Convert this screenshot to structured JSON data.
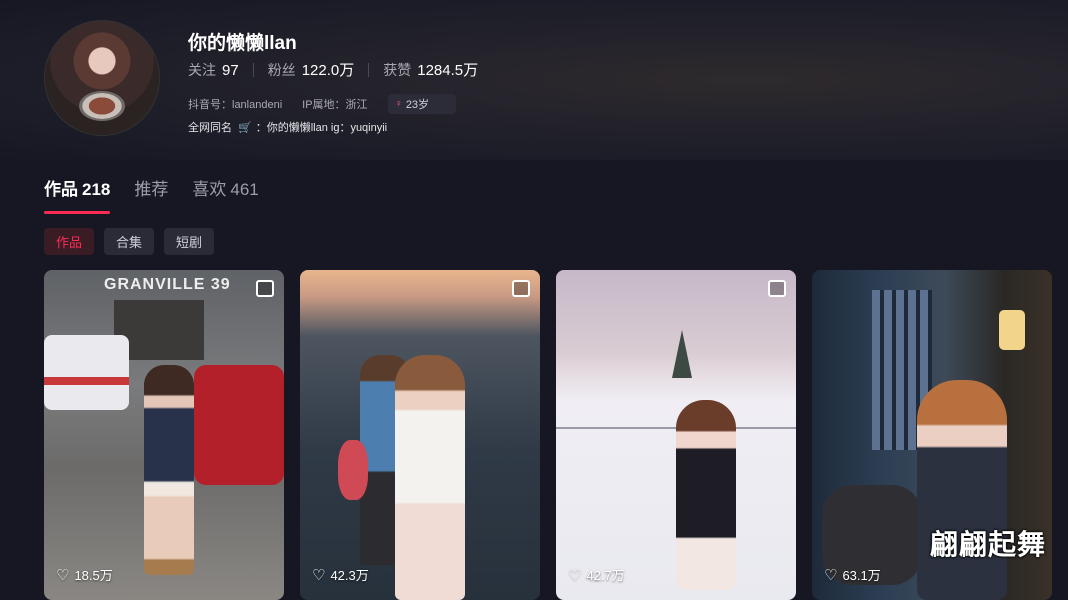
{
  "profile": {
    "name": "你的懒懒llan",
    "stats": [
      {
        "label": "关注",
        "value": "97"
      },
      {
        "label": "粉丝",
        "value": "122.0万"
      },
      {
        "label": "获赞",
        "value": "1284.5万"
      }
    ],
    "douyin_id": "抖音号：lanlandeni",
    "ip_location": "IP属地：浙江",
    "age_badge": "23岁",
    "age_icon": "gender-female-icon",
    "signature_prefix": "全网同名",
    "signature_suffix": "：你的懒懒llan ig：yuqinyii"
  },
  "tabs": [
    {
      "label": "作品",
      "count": "218",
      "active": true
    },
    {
      "label": "推荐",
      "count": "",
      "active": false
    },
    {
      "label": "喜欢",
      "count": "461",
      "active": false
    }
  ],
  "chips": [
    {
      "label": "作品",
      "active": true
    },
    {
      "label": "合集",
      "active": false
    },
    {
      "label": "短剧",
      "active": false
    }
  ],
  "videos": [
    {
      "likes": "18.5万",
      "multi": true,
      "sign_text": "GRANVILLE 39"
    },
    {
      "likes": "42.3万",
      "multi": true
    },
    {
      "likes": "42.7万",
      "multi": true
    },
    {
      "likes": "63.1万",
      "multi": false,
      "caption": "翩翩起舞"
    }
  ],
  "colors": {
    "accent": "#fe2c55",
    "background": "#161722"
  }
}
